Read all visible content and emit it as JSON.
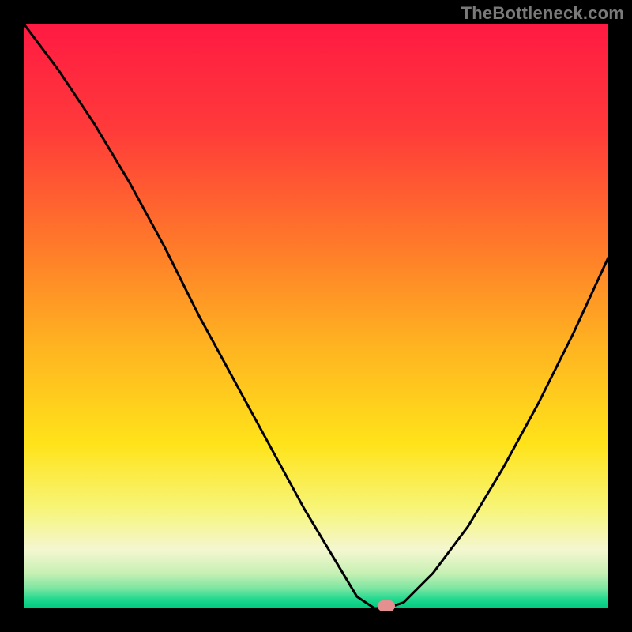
{
  "watermark": "TheBottleneck.com",
  "chart_data": {
    "type": "line",
    "title": "",
    "xlabel": "",
    "ylabel": "",
    "x_range": [
      0,
      100
    ],
    "y_range": [
      0,
      100
    ],
    "series": [
      {
        "name": "bottleneck-curve",
        "x": [
          0,
          6,
          12,
          18,
          24,
          30,
          36,
          42,
          48,
          54,
          57,
          60,
          62,
          65,
          70,
          76,
          82,
          88,
          94,
          100
        ],
        "y": [
          100,
          92,
          83,
          73,
          62,
          50,
          39,
          28,
          17,
          7,
          2,
          0,
          0,
          1,
          6,
          14,
          24,
          35,
          47,
          60
        ]
      }
    ],
    "floor_marker_x": 62,
    "gradient_stops": [
      {
        "offset": 0.0,
        "color": "#ff1a43"
      },
      {
        "offset": 0.18,
        "color": "#ff3a3a"
      },
      {
        "offset": 0.38,
        "color": "#ff7a2a"
      },
      {
        "offset": 0.55,
        "color": "#ffb321"
      },
      {
        "offset": 0.72,
        "color": "#ffe31a"
      },
      {
        "offset": 0.83,
        "color": "#f7f579"
      },
      {
        "offset": 0.9,
        "color": "#f4f7d0"
      },
      {
        "offset": 0.94,
        "color": "#c7f0b4"
      },
      {
        "offset": 0.965,
        "color": "#7fe6a3"
      },
      {
        "offset": 0.985,
        "color": "#1fd88e"
      },
      {
        "offset": 1.0,
        "color": "#00c97e"
      }
    ]
  }
}
